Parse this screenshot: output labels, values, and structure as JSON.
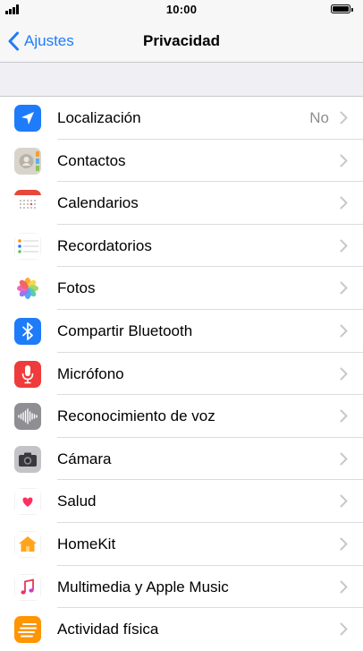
{
  "status": {
    "time": "10:00"
  },
  "nav": {
    "back_label": "Ajustes",
    "title": "Privacidad"
  },
  "rows": [
    {
      "label": "Localización",
      "value": "No",
      "icon": "location-arrow-icon",
      "color": "#1e7cfb"
    },
    {
      "label": "Contactos",
      "value": "",
      "icon": "contacts-icon",
      "color": "#c9c3b8"
    },
    {
      "label": "Calendarios",
      "value": "",
      "icon": "calendar-icon",
      "color": "#ffffff"
    },
    {
      "label": "Recordatorios",
      "value": "",
      "icon": "reminders-icon",
      "color": "#ffffff"
    },
    {
      "label": "Fotos",
      "value": "",
      "icon": "photos-icon",
      "color": "#ffffff"
    },
    {
      "label": "Compartir Bluetooth",
      "value": "",
      "icon": "bluetooth-icon",
      "color": "#1e7cfb"
    },
    {
      "label": "Micrófono",
      "value": "",
      "icon": "microphone-icon",
      "color": "#ef3b3b"
    },
    {
      "label": "Reconocimiento de voz",
      "value": "",
      "icon": "speech-waveform-icon",
      "color": "#8e8e93"
    },
    {
      "label": "Cámara",
      "value": "",
      "icon": "camera-icon",
      "color": "#b6b6bb"
    },
    {
      "label": "Salud",
      "value": "",
      "icon": "health-heart-icon",
      "color": "#ffffff"
    },
    {
      "label": "HomeKit",
      "value": "",
      "icon": "homekit-icon",
      "color": "#ffffff"
    },
    {
      "label": "Multimedia y Apple Music",
      "value": "",
      "icon": "music-note-icon",
      "color": "#ffffff"
    },
    {
      "label": "Actividad física",
      "value": "",
      "icon": "motion-activity-icon",
      "color": "#ff9500"
    }
  ]
}
